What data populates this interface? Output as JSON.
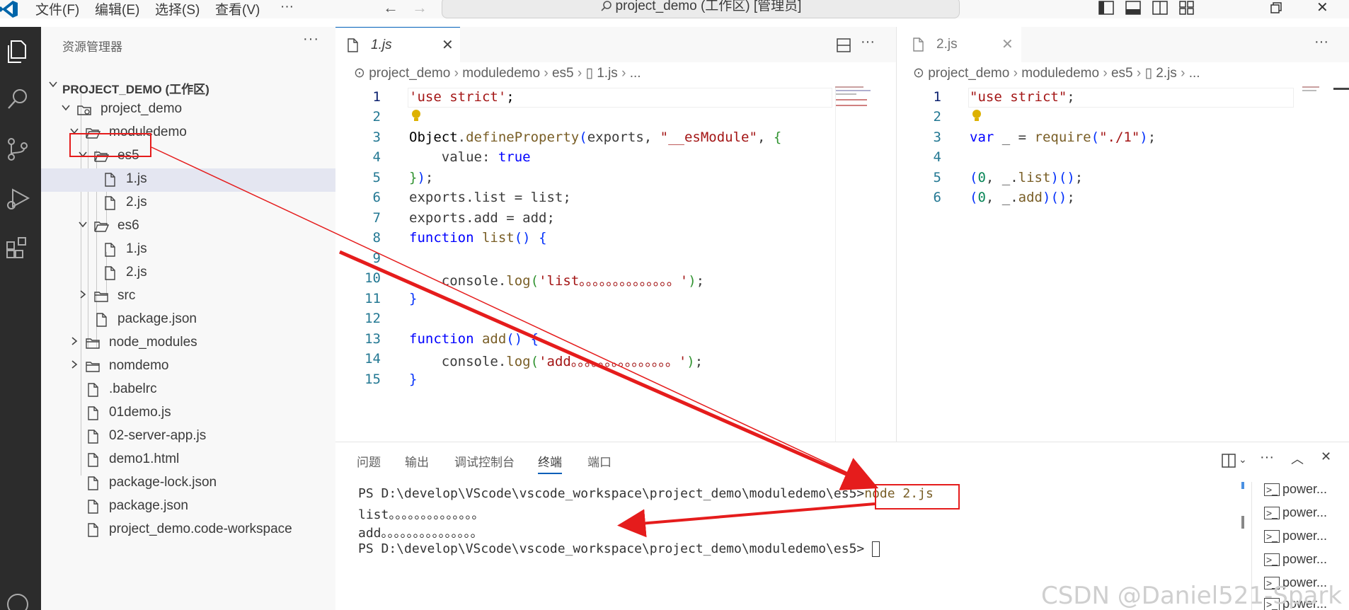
{
  "titlebar": {
    "menus": [
      "文件(F)",
      "编辑(E)",
      "选择(S)",
      "查看(V)",
      "···"
    ],
    "search_text": "project_demo (工作区) [管理员]"
  },
  "sidebar": {
    "title": "资源管理器",
    "more": "···",
    "tree": [
      {
        "label": "PROJECT_DEMO (工作区)"
      },
      {
        "label": "project_demo"
      },
      {
        "label": "moduledemo"
      },
      {
        "label": "es5"
      },
      {
        "label": "1.js"
      },
      {
        "label": "2.js"
      },
      {
        "label": "es6"
      },
      {
        "label": "1.js"
      },
      {
        "label": "2.js"
      },
      {
        "label": "src"
      },
      {
        "label": "package.json"
      },
      {
        "label": "node_modules"
      },
      {
        "label": "nomdemo"
      },
      {
        "label": ".babelrc"
      },
      {
        "label": "01demo.js"
      },
      {
        "label": "02-server-app.js"
      },
      {
        "label": "demo1.html"
      },
      {
        "label": "package-lock.json"
      },
      {
        "label": "package.json"
      },
      {
        "label": "project_demo.code-workspace"
      }
    ]
  },
  "editor_left": {
    "tab": "1.js",
    "breadcrumb": [
      "project_demo",
      "moduledemo",
      "es5",
      "1.js",
      "..."
    ],
    "line_numbers": [
      "1",
      "2",
      "3",
      "4",
      "5",
      "6",
      "7",
      "8",
      "9",
      "10",
      "11",
      "12",
      "13",
      "14",
      "15"
    ]
  },
  "editor_right": {
    "tab": "2.js",
    "breadcrumb": [
      "project_demo",
      "moduledemo",
      "es5",
      "2.js",
      "..."
    ],
    "line_numbers": [
      "1",
      "2",
      "3",
      "4",
      "5",
      "6"
    ]
  },
  "panel": {
    "tabs": [
      "问题",
      "输出",
      "调试控制台",
      "终端",
      "端口"
    ],
    "active_tab": "终端",
    "terminal": {
      "line1_prompt": "PS D:\\develop\\VScode\\vscode_workspace\\project_demo\\moduledemo\\es5>",
      "line1_cmd": "node 2.js",
      "line2": "list。。。。。。。。。。。。。。",
      "line3": "add。。。。。。。。。。。。。。。",
      "line4_prompt": "PS D:\\develop\\VScode\\vscode_workspace\\project_demo\\moduledemo\\es5>"
    },
    "instances": [
      "power...",
      "power...",
      "power...",
      "power...",
      "power...",
      "power..."
    ]
  },
  "watermark": "CSDN @Daniel521-Spark",
  "colors": {
    "accent": "#005fb8",
    "annotation_red": "#e51c1c",
    "activity_bar": "#2c2c2c"
  }
}
